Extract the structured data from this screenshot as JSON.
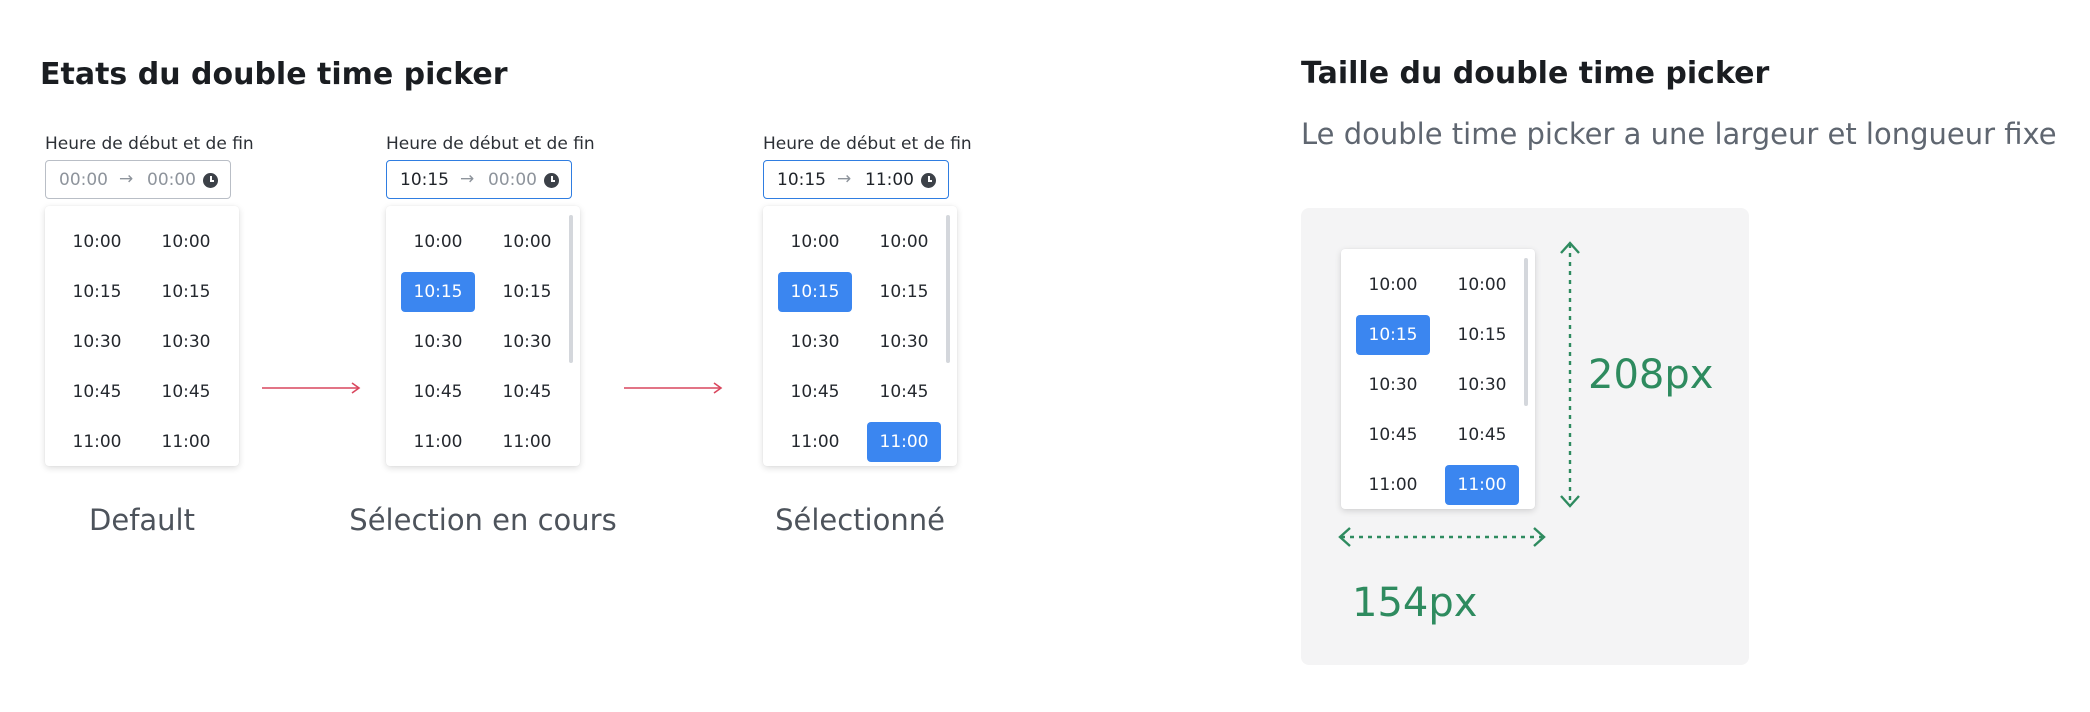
{
  "states_section": {
    "title": "Etats du double time picker",
    "states": [
      {
        "label": "Heure de début et de fin",
        "start_value": "00:00",
        "end_value": "00:00",
        "start_placeholder": true,
        "end_placeholder": true,
        "focused": false,
        "scrollbar": false,
        "columns": [
          {
            "options": [
              "10:00",
              "10:15",
              "10:30",
              "10:45",
              "11:00"
            ],
            "selected": null
          },
          {
            "options": [
              "10:00",
              "10:15",
              "10:30",
              "10:45",
              "11:00"
            ],
            "selected": null
          }
        ],
        "caption": "Default"
      },
      {
        "label": "Heure de début et de fin",
        "start_value": "10:15",
        "end_value": "00:00",
        "start_placeholder": false,
        "end_placeholder": true,
        "focused": true,
        "scrollbar": true,
        "columns": [
          {
            "options": [
              "10:00",
              "10:15",
              "10:30",
              "10:45",
              "11:00"
            ],
            "selected": 1
          },
          {
            "options": [
              "10:00",
              "10:15",
              "10:30",
              "10:45",
              "11:00"
            ],
            "selected": null
          }
        ],
        "caption": "Sélection en cours"
      },
      {
        "label": "Heure de début et de fin",
        "start_value": "10:15",
        "end_value": "11:00",
        "start_placeholder": false,
        "end_placeholder": false,
        "focused": true,
        "scrollbar": true,
        "columns": [
          {
            "options": [
              "10:00",
              "10:15",
              "10:30",
              "10:45",
              "11:00"
            ],
            "selected": 1
          },
          {
            "options": [
              "10:00",
              "10:15",
              "10:30",
              "10:45",
              "11:00"
            ],
            "selected": 4
          }
        ],
        "caption": "Sélectionné"
      }
    ],
    "field_arrow": "→",
    "icons": {
      "field": "clock-icon",
      "transition": "arrow-right-icon"
    }
  },
  "size_section": {
    "title": "Taille du double time picker",
    "subtitle": "Le double time picker a une largeur et longueur fixe",
    "picker": {
      "columns": [
        {
          "options": [
            "10:00",
            "10:15",
            "10:30",
            "10:45",
            "11:00"
          ],
          "selected": 1
        },
        {
          "options": [
            "10:00",
            "10:15",
            "10:30",
            "10:45",
            "11:00"
          ],
          "selected": 4
        }
      ]
    },
    "height_label": "208px",
    "width_label": "154px"
  },
  "colors": {
    "accent_blue": "#3b86f0",
    "focus_border": "#2f7de1",
    "transition_arrow": "#d9475e",
    "dimension_green": "#2e8b5f",
    "panel_background": "#f4f4f5"
  }
}
